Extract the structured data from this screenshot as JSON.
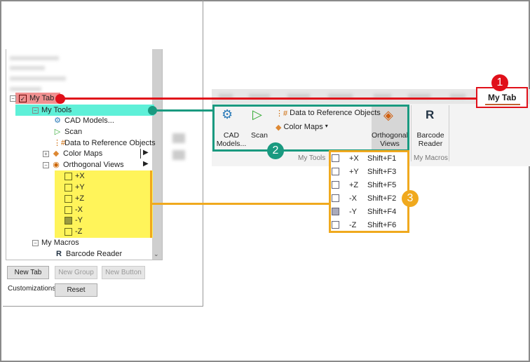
{
  "tree": {
    "my_tab": "My Tab",
    "my_tools": "My Tools",
    "tools": [
      "CAD Models...",
      "Scan",
      "Data to Reference Objects",
      "Color Maps",
      "Orthogonal Views"
    ],
    "views": [
      "+X",
      "+Y",
      "+Z",
      "-X",
      "-Y",
      "-Z"
    ],
    "my_macros": "My Macros",
    "barcode": "Barcode Reader"
  },
  "buttons": {
    "new_tab": "New Tab",
    "new_group": "New Group",
    "new_button": "New Button",
    "customizations": "Customizations",
    "reset": "Reset"
  },
  "ribbon": {
    "active_tab": "My Tab",
    "cad": "CAD Models...",
    "scan": "Scan",
    "data_ref": "Data to Reference Objects",
    "color_maps": "Color Maps",
    "ortho": "Orthogonal Views",
    "barcode": "Barcode Reader",
    "barcode_icon": "R",
    "group_tools": "My Tools",
    "group_macros": "My Macros"
  },
  "menu": [
    {
      "label": "+X",
      "shortcut": "Shift+F1"
    },
    {
      "label": "+Y",
      "shortcut": "Shift+F3"
    },
    {
      "label": "+Z",
      "shortcut": "Shift+F5"
    },
    {
      "label": "-X",
      "shortcut": "Shift+F2"
    },
    {
      "label": "-Y",
      "shortcut": "Shift+F4"
    },
    {
      "label": "-Z",
      "shortcut": "Shift+F6"
    }
  ],
  "badges": [
    "1",
    "2",
    "3"
  ],
  "colors": {
    "red": "#e0101a",
    "teal": "#1a9a80",
    "orange": "#f0a91e",
    "yellow": "#fff45a",
    "cyan": "#5ef0d8"
  }
}
